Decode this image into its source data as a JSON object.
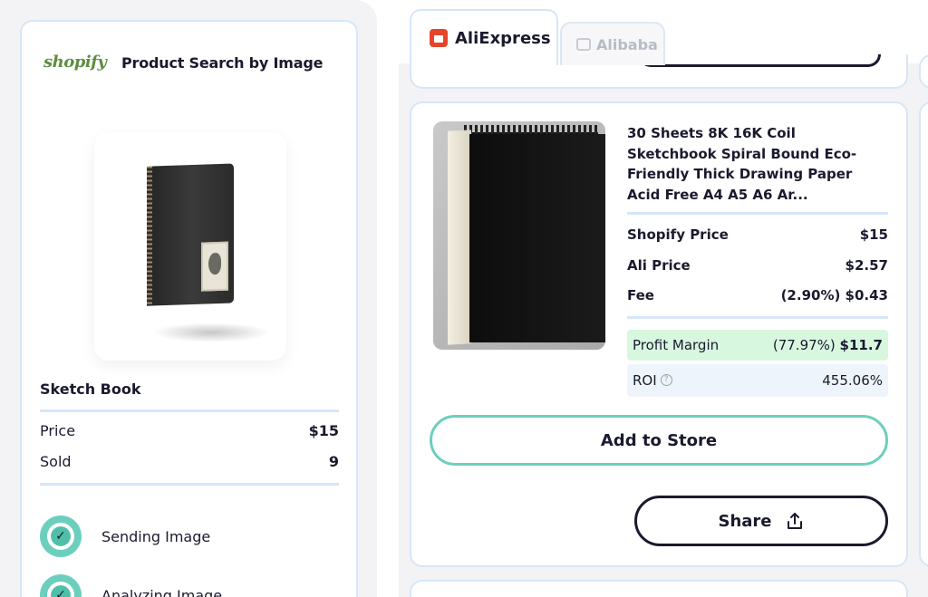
{
  "left_panel": {
    "brand": "shopify",
    "app_title": "Product Search by Image",
    "product": {
      "name": "Sketch Book",
      "price_label": "Price",
      "price_value": "$15",
      "sold_label": "Sold",
      "sold_value": "9"
    },
    "steps": [
      {
        "label": "Sending Image",
        "status": "done",
        "icon": "check-icon"
      },
      {
        "label": "Analyzing Image",
        "status": "done",
        "icon": "check-icon"
      }
    ]
  },
  "tabs": [
    {
      "label": "AliExpress",
      "active": true,
      "icon": "aliexpress-logo-icon"
    },
    {
      "label": "Alibaba",
      "active": false,
      "icon": "alibaba-logo-icon"
    }
  ],
  "result": {
    "title_lines": [
      "30 Sheets 8K 16K Coil",
      "Sketchbook Spiral Bound Eco-",
      "Friendly Thick Drawing Paper",
      "Acid Free A4 A5 A6 Ar..."
    ],
    "shopify_price_label": "Shopify Price",
    "shopify_price_value": "$15",
    "ali_price_label": "Ali Price",
    "ali_price_value": "$2.57",
    "fee_label": "Fee",
    "fee_value": "(2.90%) $0.43",
    "profit_label": "Profit Margin",
    "profit_pct": "(77.97%)",
    "profit_value": "$11.7",
    "roi_label": "ROI",
    "roi_value": "455.06%",
    "add_button": "Add to Store",
    "share_button": "Share"
  },
  "colors": {
    "accent_teal": "#6ccfbe",
    "border_blue": "#d7e6f7",
    "profit_green_bg": "#d8f7df",
    "shopify_green": "#5e8e3e",
    "aliexpress_red": "#e5452b",
    "text_dark": "#1a1a2e"
  }
}
